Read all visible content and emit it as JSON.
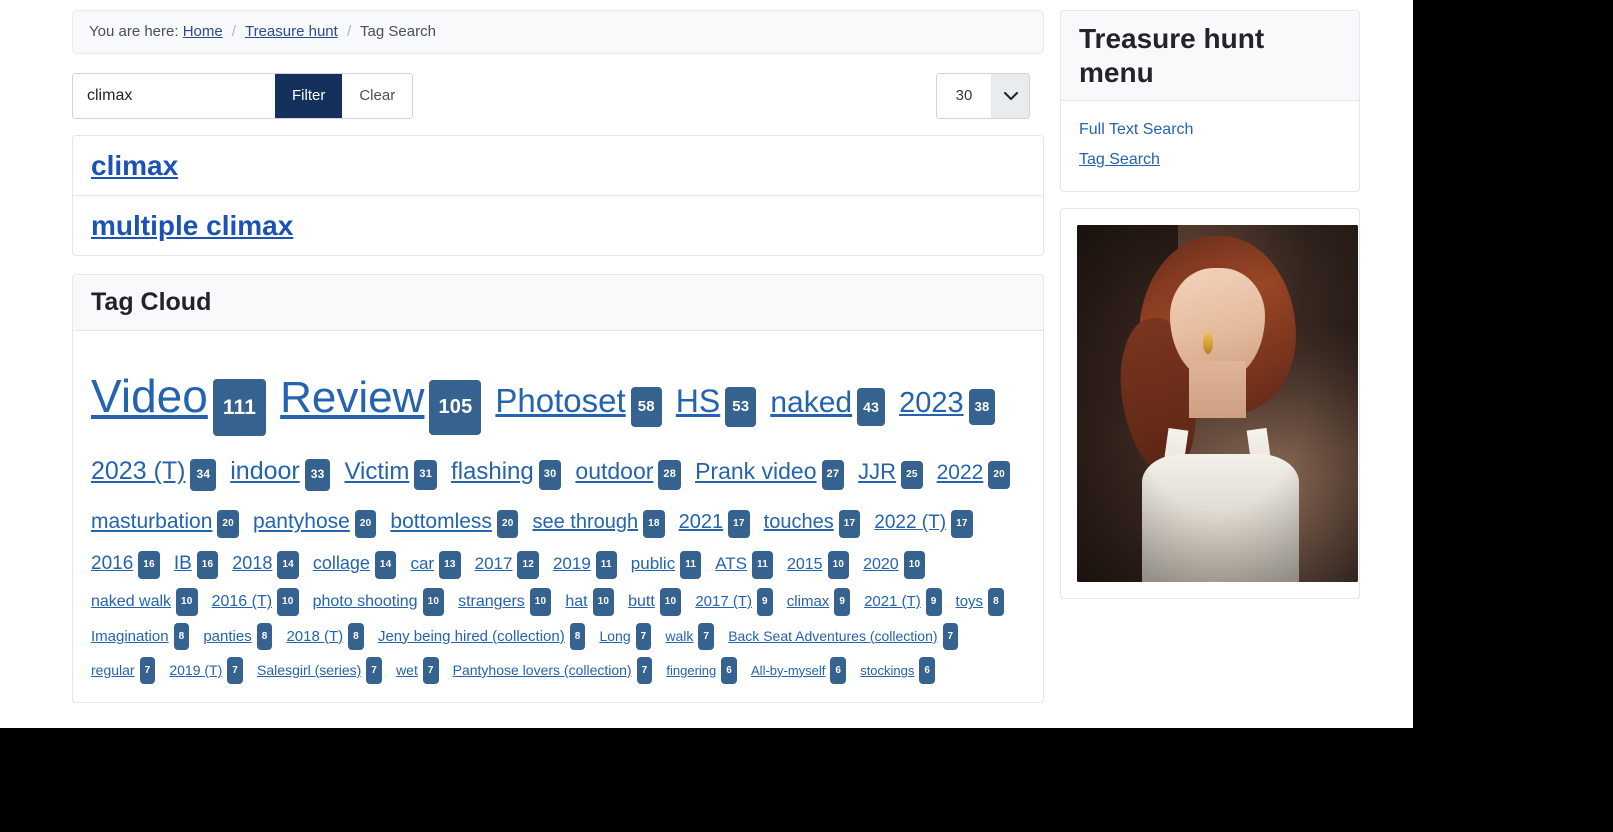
{
  "breadcrumb": {
    "lead": "You are here:",
    "items": [
      {
        "label": "Home",
        "link": true
      },
      {
        "label": "Treasure hunt",
        "link": true
      },
      {
        "label": "Tag Search",
        "link": false
      }
    ],
    "separator": "/"
  },
  "search": {
    "value": "climax",
    "placeholder": "",
    "filter_label": "Filter",
    "clear_label": "Clear",
    "per_page_value": "30",
    "per_page_icon": "chevron-down-icon"
  },
  "results": [
    {
      "label": "climax"
    },
    {
      "label": "multiple climax"
    }
  ],
  "tag_cloud": {
    "title": "Tag Cloud",
    "tags": [
      {
        "label": "Video",
        "count": "111",
        "size": 46
      },
      {
        "label": "Review",
        "count": "105",
        "size": 44
      },
      {
        "label": "Photoset",
        "count": "58",
        "size": 33
      },
      {
        "label": "HS",
        "count": "53",
        "size": 32
      },
      {
        "label": "naked",
        "count": "43",
        "size": 30
      },
      {
        "label": "2023",
        "count": "38",
        "size": 29
      },
      {
        "label": "2023 (T)",
        "count": "34",
        "size": 25
      },
      {
        "label": "indoor",
        "count": "33",
        "size": 25
      },
      {
        "label": "Victim",
        "count": "31",
        "size": 24
      },
      {
        "label": "flashing",
        "count": "30",
        "size": 24
      },
      {
        "label": "outdoor",
        "count": "28",
        "size": 23
      },
      {
        "label": "Prank video",
        "count": "27",
        "size": 23
      },
      {
        "label": "JJR",
        "count": "25",
        "size": 22
      },
      {
        "label": "2022",
        "count": "20",
        "size": 21
      },
      {
        "label": "masturbation",
        "count": "20",
        "size": 21
      },
      {
        "label": "pantyhose",
        "count": "20",
        "size": 21
      },
      {
        "label": "bottomless",
        "count": "20",
        "size": 21
      },
      {
        "label": "see through",
        "count": "18",
        "size": 20
      },
      {
        "label": "2021",
        "count": "17",
        "size": 20
      },
      {
        "label": "touches",
        "count": "17",
        "size": 20
      },
      {
        "label": "2022 (T)",
        "count": "17",
        "size": 19
      },
      {
        "label": "2016",
        "count": "16",
        "size": 19
      },
      {
        "label": "IB",
        "count": "16",
        "size": 19
      },
      {
        "label": "2018",
        "count": "14",
        "size": 18
      },
      {
        "label": "collage",
        "count": "14",
        "size": 18
      },
      {
        "label": "car",
        "count": "13",
        "size": 17
      },
      {
        "label": "2017",
        "count": "12",
        "size": 17
      },
      {
        "label": "2019",
        "count": "11",
        "size": 17
      },
      {
        "label": "public",
        "count": "11",
        "size": 17
      },
      {
        "label": "ATS",
        "count": "11",
        "size": 17
      },
      {
        "label": "2015",
        "count": "10",
        "size": 16
      },
      {
        "label": "2020",
        "count": "10",
        "size": 16
      },
      {
        "label": "naked walk",
        "count": "10",
        "size": 16
      },
      {
        "label": "2016 (T)",
        "count": "10",
        "size": 16
      },
      {
        "label": "photo shooting",
        "count": "10",
        "size": 16
      },
      {
        "label": "strangers",
        "count": "10",
        "size": 16
      },
      {
        "label": "hat",
        "count": "10",
        "size": 16
      },
      {
        "label": "butt",
        "count": "10",
        "size": 16
      },
      {
        "label": "2017 (T)",
        "count": "9",
        "size": 15
      },
      {
        "label": "climax",
        "count": "9",
        "size": 15
      },
      {
        "label": "2021 (T)",
        "count": "9",
        "size": 15
      },
      {
        "label": "toys",
        "count": "8",
        "size": 15
      },
      {
        "label": "Imagination",
        "count": "8",
        "size": 15
      },
      {
        "label": "panties",
        "count": "8",
        "size": 15
      },
      {
        "label": "2018 (T)",
        "count": "8",
        "size": 15
      },
      {
        "label": "Jeny being hired (collection)",
        "count": "8",
        "size": 15
      },
      {
        "label": "Long",
        "count": "7",
        "size": 14
      },
      {
        "label": "walk",
        "count": "7",
        "size": 14
      },
      {
        "label": "Back Seat Adventures (collection)",
        "count": "7",
        "size": 14
      },
      {
        "label": "regular",
        "count": "7",
        "size": 14
      },
      {
        "label": "2019 (T)",
        "count": "7",
        "size": 14
      },
      {
        "label": "Salesgirl (series)",
        "count": "7",
        "size": 14
      },
      {
        "label": "wet",
        "count": "7",
        "size": 14
      },
      {
        "label": "Pantyhose lovers (collection)",
        "count": "7",
        "size": 14
      },
      {
        "label": "fingering",
        "count": "6",
        "size": 13
      },
      {
        "label": "All-by-myself",
        "count": "6",
        "size": 13
      },
      {
        "label": "stockings",
        "count": "6",
        "size": 13
      }
    ]
  },
  "sidebar": {
    "title": "Treasure hunt menu",
    "links": [
      {
        "label": "Full Text Search",
        "active": false
      },
      {
        "label": "Tag Search",
        "active": true
      }
    ],
    "image_alt": "woman-portrait-photo"
  },
  "colors": {
    "link": "#2463b0",
    "result_link": "#1a52b5",
    "badge_bg": "#35628f",
    "filter_btn_bg": "#14305c",
    "panel_head_bg": "#f8f9fa",
    "border": "#e3e6ea"
  }
}
